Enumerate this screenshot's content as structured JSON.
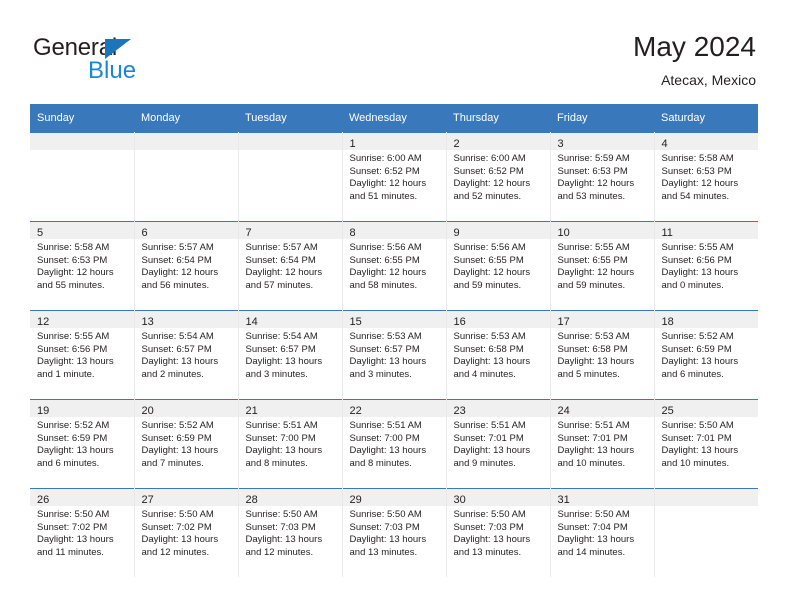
{
  "brand": {
    "name_part1": "General",
    "name_part2": "Blue",
    "accent_color": "#1b87d2",
    "triangle_color": "#1b75bb"
  },
  "header": {
    "title": "May 2024",
    "subtitle": "Atecax, Mexico"
  },
  "theme": {
    "header_row_bg": "#3a78bc",
    "daynum_band_bg": "#f0f0f0",
    "cell_bg": "#ffffff",
    "text_color": "#231f20"
  },
  "weekdays": [
    "Sunday",
    "Monday",
    "Tuesday",
    "Wednesday",
    "Thursday",
    "Friday",
    "Saturday"
  ],
  "weeks": [
    [
      {
        "day": "",
        "sunrise": "",
        "sunset": "",
        "daylight_line1": "",
        "daylight_line2": ""
      },
      {
        "day": "",
        "sunrise": "",
        "sunset": "",
        "daylight_line1": "",
        "daylight_line2": ""
      },
      {
        "day": "",
        "sunrise": "",
        "sunset": "",
        "daylight_line1": "",
        "daylight_line2": ""
      },
      {
        "day": "1",
        "sunrise": "Sunrise: 6:00 AM",
        "sunset": "Sunset: 6:52 PM",
        "daylight_line1": "Daylight: 12 hours",
        "daylight_line2": "and 51 minutes."
      },
      {
        "day": "2",
        "sunrise": "Sunrise: 6:00 AM",
        "sunset": "Sunset: 6:52 PM",
        "daylight_line1": "Daylight: 12 hours",
        "daylight_line2": "and 52 minutes."
      },
      {
        "day": "3",
        "sunrise": "Sunrise: 5:59 AM",
        "sunset": "Sunset: 6:53 PM",
        "daylight_line1": "Daylight: 12 hours",
        "daylight_line2": "and 53 minutes."
      },
      {
        "day": "4",
        "sunrise": "Sunrise: 5:58 AM",
        "sunset": "Sunset: 6:53 PM",
        "daylight_line1": "Daylight: 12 hours",
        "daylight_line2": "and 54 minutes."
      }
    ],
    [
      {
        "day": "5",
        "sunrise": "Sunrise: 5:58 AM",
        "sunset": "Sunset: 6:53 PM",
        "daylight_line1": "Daylight: 12 hours",
        "daylight_line2": "and 55 minutes."
      },
      {
        "day": "6",
        "sunrise": "Sunrise: 5:57 AM",
        "sunset": "Sunset: 6:54 PM",
        "daylight_line1": "Daylight: 12 hours",
        "daylight_line2": "and 56 minutes."
      },
      {
        "day": "7",
        "sunrise": "Sunrise: 5:57 AM",
        "sunset": "Sunset: 6:54 PM",
        "daylight_line1": "Daylight: 12 hours",
        "daylight_line2": "and 57 minutes."
      },
      {
        "day": "8",
        "sunrise": "Sunrise: 5:56 AM",
        "sunset": "Sunset: 6:55 PM",
        "daylight_line1": "Daylight: 12 hours",
        "daylight_line2": "and 58 minutes."
      },
      {
        "day": "9",
        "sunrise": "Sunrise: 5:56 AM",
        "sunset": "Sunset: 6:55 PM",
        "daylight_line1": "Daylight: 12 hours",
        "daylight_line2": "and 59 minutes."
      },
      {
        "day": "10",
        "sunrise": "Sunrise: 5:55 AM",
        "sunset": "Sunset: 6:55 PM",
        "daylight_line1": "Daylight: 12 hours",
        "daylight_line2": "and 59 minutes."
      },
      {
        "day": "11",
        "sunrise": "Sunrise: 5:55 AM",
        "sunset": "Sunset: 6:56 PM",
        "daylight_line1": "Daylight: 13 hours",
        "daylight_line2": "and 0 minutes."
      }
    ],
    [
      {
        "day": "12",
        "sunrise": "Sunrise: 5:55 AM",
        "sunset": "Sunset: 6:56 PM",
        "daylight_line1": "Daylight: 13 hours",
        "daylight_line2": "and 1 minute."
      },
      {
        "day": "13",
        "sunrise": "Sunrise: 5:54 AM",
        "sunset": "Sunset: 6:57 PM",
        "daylight_line1": "Daylight: 13 hours",
        "daylight_line2": "and 2 minutes."
      },
      {
        "day": "14",
        "sunrise": "Sunrise: 5:54 AM",
        "sunset": "Sunset: 6:57 PM",
        "daylight_line1": "Daylight: 13 hours",
        "daylight_line2": "and 3 minutes."
      },
      {
        "day": "15",
        "sunrise": "Sunrise: 5:53 AM",
        "sunset": "Sunset: 6:57 PM",
        "daylight_line1": "Daylight: 13 hours",
        "daylight_line2": "and 3 minutes."
      },
      {
        "day": "16",
        "sunrise": "Sunrise: 5:53 AM",
        "sunset": "Sunset: 6:58 PM",
        "daylight_line1": "Daylight: 13 hours",
        "daylight_line2": "and 4 minutes."
      },
      {
        "day": "17",
        "sunrise": "Sunrise: 5:53 AM",
        "sunset": "Sunset: 6:58 PM",
        "daylight_line1": "Daylight: 13 hours",
        "daylight_line2": "and 5 minutes."
      },
      {
        "day": "18",
        "sunrise": "Sunrise: 5:52 AM",
        "sunset": "Sunset: 6:59 PM",
        "daylight_line1": "Daylight: 13 hours",
        "daylight_line2": "and 6 minutes."
      }
    ],
    [
      {
        "day": "19",
        "sunrise": "Sunrise: 5:52 AM",
        "sunset": "Sunset: 6:59 PM",
        "daylight_line1": "Daylight: 13 hours",
        "daylight_line2": "and 6 minutes."
      },
      {
        "day": "20",
        "sunrise": "Sunrise: 5:52 AM",
        "sunset": "Sunset: 6:59 PM",
        "daylight_line1": "Daylight: 13 hours",
        "daylight_line2": "and 7 minutes."
      },
      {
        "day": "21",
        "sunrise": "Sunrise: 5:51 AM",
        "sunset": "Sunset: 7:00 PM",
        "daylight_line1": "Daylight: 13 hours",
        "daylight_line2": "and 8 minutes."
      },
      {
        "day": "22",
        "sunrise": "Sunrise: 5:51 AM",
        "sunset": "Sunset: 7:00 PM",
        "daylight_line1": "Daylight: 13 hours",
        "daylight_line2": "and 8 minutes."
      },
      {
        "day": "23",
        "sunrise": "Sunrise: 5:51 AM",
        "sunset": "Sunset: 7:01 PM",
        "daylight_line1": "Daylight: 13 hours",
        "daylight_line2": "and 9 minutes."
      },
      {
        "day": "24",
        "sunrise": "Sunrise: 5:51 AM",
        "sunset": "Sunset: 7:01 PM",
        "daylight_line1": "Daylight: 13 hours",
        "daylight_line2": "and 10 minutes."
      },
      {
        "day": "25",
        "sunrise": "Sunrise: 5:50 AM",
        "sunset": "Sunset: 7:01 PM",
        "daylight_line1": "Daylight: 13 hours",
        "daylight_line2": "and 10 minutes."
      }
    ],
    [
      {
        "day": "26",
        "sunrise": "Sunrise: 5:50 AM",
        "sunset": "Sunset: 7:02 PM",
        "daylight_line1": "Daylight: 13 hours",
        "daylight_line2": "and 11 minutes."
      },
      {
        "day": "27",
        "sunrise": "Sunrise: 5:50 AM",
        "sunset": "Sunset: 7:02 PM",
        "daylight_line1": "Daylight: 13 hours",
        "daylight_line2": "and 12 minutes."
      },
      {
        "day": "28",
        "sunrise": "Sunrise: 5:50 AM",
        "sunset": "Sunset: 7:03 PM",
        "daylight_line1": "Daylight: 13 hours",
        "daylight_line2": "and 12 minutes."
      },
      {
        "day": "29",
        "sunrise": "Sunrise: 5:50 AM",
        "sunset": "Sunset: 7:03 PM",
        "daylight_line1": "Daylight: 13 hours",
        "daylight_line2": "and 13 minutes."
      },
      {
        "day": "30",
        "sunrise": "Sunrise: 5:50 AM",
        "sunset": "Sunset: 7:03 PM",
        "daylight_line1": "Daylight: 13 hours",
        "daylight_line2": "and 13 minutes."
      },
      {
        "day": "31",
        "sunrise": "Sunrise: 5:50 AM",
        "sunset": "Sunset: 7:04 PM",
        "daylight_line1": "Daylight: 13 hours",
        "daylight_line2": "and 14 minutes."
      },
      {
        "day": "",
        "sunrise": "",
        "sunset": "",
        "daylight_line1": "",
        "daylight_line2": ""
      }
    ]
  ]
}
